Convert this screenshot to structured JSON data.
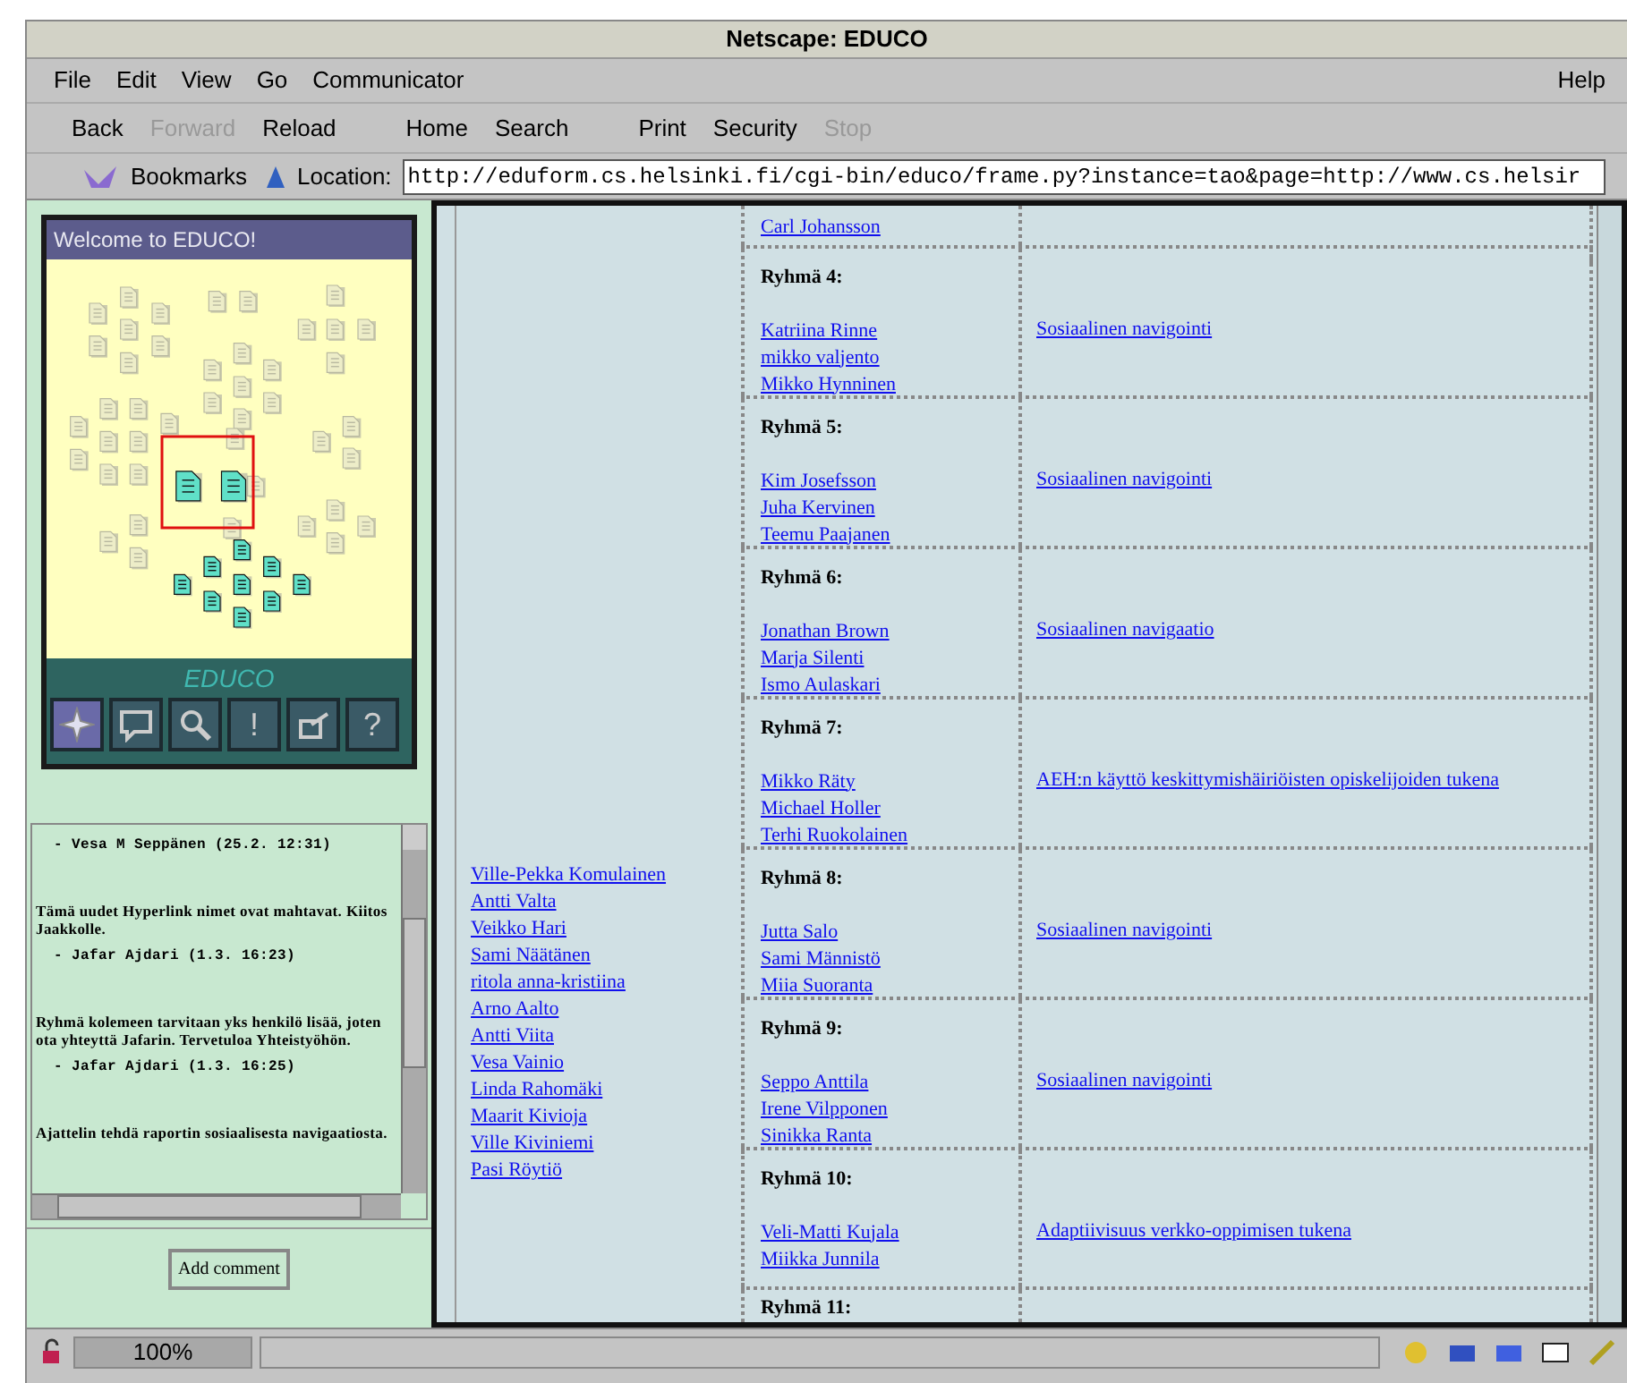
{
  "window": {
    "title": "Netscape: EDUCO"
  },
  "menu": {
    "items": [
      "File",
      "Edit",
      "View",
      "Go",
      "Communicator"
    ],
    "help": "Help"
  },
  "toolbar": [
    {
      "label": "Back",
      "disabled": false
    },
    {
      "label": "Forward",
      "disabled": true
    },
    {
      "label": "Reload",
      "disabled": false
    },
    {
      "label": "Home",
      "disabled": false
    },
    {
      "label": "Search",
      "disabled": false
    },
    {
      "label": "Print",
      "disabled": false
    },
    {
      "label": "Security",
      "disabled": false
    },
    {
      "label": "Stop",
      "disabled": true
    }
  ],
  "location_bar": {
    "bookmarks": "Bookmarks",
    "location_label": "Location:",
    "url": "http://eduform.cs.helsinki.fi/cgi-bin/educo/frame.py?instance=tao&page=http://www.cs.helsir"
  },
  "educo_panel": {
    "title": "Welcome to EDUCO!",
    "logo": "EDUCO",
    "tools": [
      {
        "kind": "compass",
        "selected": true
      },
      {
        "kind": "chat",
        "selected": false
      },
      {
        "kind": "magnifier",
        "selected": false
      },
      {
        "kind": "glyph",
        "label": "!",
        "selected": false
      },
      {
        "kind": "vote",
        "selected": false
      },
      {
        "kind": "glyph",
        "label": "?",
        "selected": false
      }
    ]
  },
  "comments": [
    {
      "signature": "- Vesa M Seppänen (25.2. 12:31)"
    },
    {
      "text": "Tämä uudet Hyperlink nimet ovat mahtavat. Kiitos Jaakkolle.",
      "signature": "- Jafar Ajdari (1.3. 16:23)"
    },
    {
      "text": "Ryhmä kolemeen tarvitaan yks henkilö lisää, joten ota yhteyttä Jafarin. Tervetuloa Yhteistyöhön.",
      "signature": "- Jafar Ajdari (1.3. 16:25)"
    },
    {
      "text": "Ajattelin tehdä raportin sosiaalisesta navigaatiosta."
    }
  ],
  "add_comment_button": "Add comment",
  "page": {
    "unassigned": [
      "Ville-Pekka Komulainen",
      "Antti Valta",
      "Veikko Hari",
      "Sami Näätänen",
      "ritola anna-kristiina",
      "Arno Aalto",
      "Antti Viita",
      "Vesa Vainio",
      "Linda Rahomäki",
      "Maarit Kivioja",
      "Ville Kiviniemi",
      "Pasi Röytiö"
    ],
    "groups": [
      {
        "members": [
          "Carl Johansson"
        ]
      },
      {
        "heading": "Ryhmä 4:",
        "members": [
          "Katriina Rinne",
          "mikko valjento",
          "Mikko Hynninen"
        ],
        "topic": "Sosiaalinen navigointi"
      },
      {
        "heading": "Ryhmä 5:",
        "members": [
          "Kim Josefsson",
          "Juha Kervinen",
          "Teemu Paajanen"
        ],
        "topic": "Sosiaalinen navigointi"
      },
      {
        "heading": "Ryhmä 6:",
        "members": [
          "Jonathan Brown",
          "Marja Silenti",
          "Ismo Aulaskari"
        ],
        "topic": "Sosiaalinen navigaatio"
      },
      {
        "heading": "Ryhmä 7:",
        "members": [
          "Mikko Räty",
          "Michael Holler",
          "Terhi Ruokolainen"
        ],
        "topic": "AEH:n käyttö keskittymishäiriöisten opiskelijoiden tukena"
      },
      {
        "heading": "Ryhmä 8:",
        "members": [
          "Jutta Salo",
          "Sami Männistö",
          "Miia Suoranta"
        ],
        "topic": "Sosiaalinen navigointi"
      },
      {
        "heading": "Ryhmä 9:",
        "members": [
          "Seppo Anttila",
          "Irene Vilpponen",
          "Sinikka Ranta"
        ],
        "topic": "Sosiaalinen navigointi"
      },
      {
        "heading": "Ryhmä 10:",
        "members": [
          "Veli-Matti Kujala",
          "Miikka Junnila"
        ],
        "topic": "Adaptiivisuus verkko-oppimisen tukena"
      },
      {
        "heading": "Ryhmä 11:"
      }
    ]
  },
  "status_bar": {
    "zoom": "100%"
  }
}
